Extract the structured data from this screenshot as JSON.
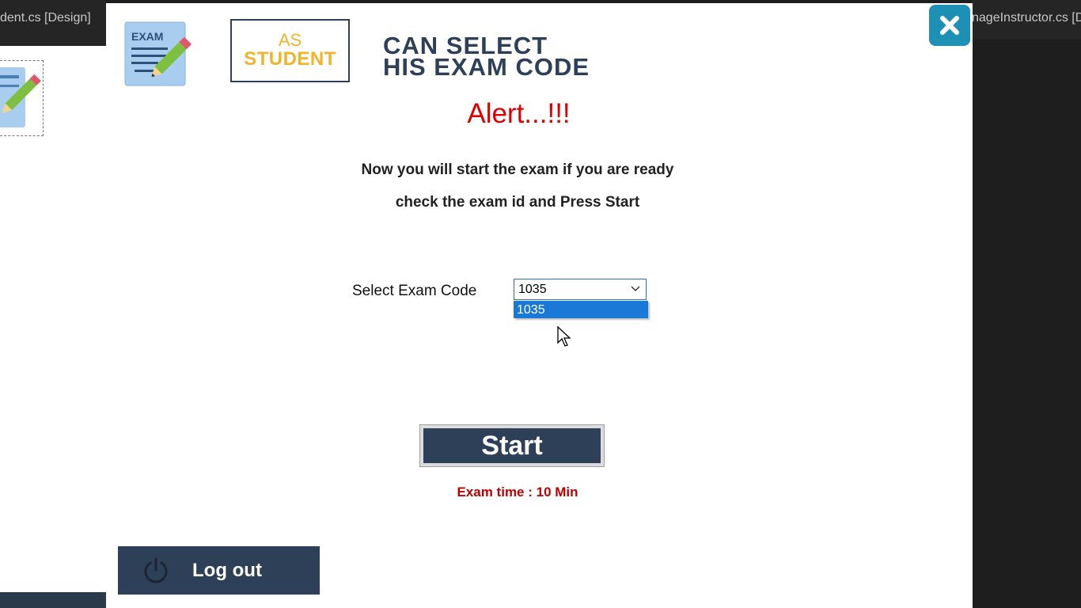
{
  "ide": {
    "left_tab": "dent.cs [Design]",
    "right_tab": "nageInstructor.cs [Design]"
  },
  "header": {
    "exam_icon_label": "EXAM",
    "role_small": "AS",
    "role_big": "STUDENT",
    "banner_line1": "CAN SELECT",
    "banner_line2": "HIS EXAM CODE"
  },
  "alert": {
    "title": "Alert...!!!",
    "line1": "Now you will start the exam if you are ready",
    "line2": "check the exam id and Press Start"
  },
  "exam_select": {
    "label": "Select Exam Code",
    "selected": "1035",
    "options": [
      "1035"
    ]
  },
  "actions": {
    "start_label": "Start",
    "exam_time": "Exam time : 10 Min",
    "logout_label": "Log out"
  },
  "colors": {
    "brand_navy": "#2d4057",
    "accent_yellow": "#f0b429",
    "alert_red": "#e00000",
    "close_blue": "#1e8fb5",
    "selection_blue": "#1a78d6"
  }
}
